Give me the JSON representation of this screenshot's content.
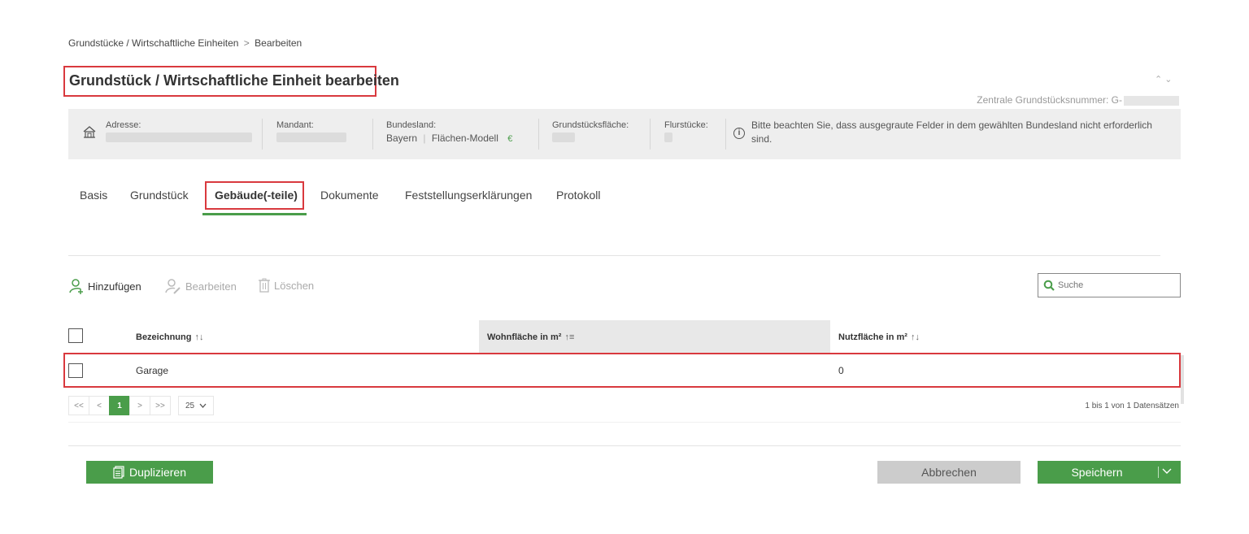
{
  "breadcrumb": {
    "parent": "Grundstücke / Wirtschaftliche Einheiten",
    "separator": ">",
    "current": "Bearbeiten"
  },
  "page_title": "Grundstück / Wirtschaftliche Einheit bearbeiten",
  "central_number_label": "Zentrale Grundstücksnummer: G-",
  "infobar": {
    "address_label": "Adresse:",
    "client_label": "Mandant:",
    "state_label": "Bundesland:",
    "state_value": "Bayern",
    "model_value": "Flächen-Modell",
    "model_icon": "€",
    "area_label": "Grundstücksfläche:",
    "parcels_label": "Flurstücke:",
    "note": "Bitte beachten Sie, dass ausgegraute Felder in dem gewählten Bundesland nicht erforderlich sind."
  },
  "tabs": [
    "Basis",
    "Grundstück",
    "Gebäude(-teile)",
    "Dokumente",
    "Feststellungserklärungen",
    "Protokoll"
  ],
  "active_tab": "Gebäude(-teile)",
  "toolbar": {
    "add_label": "Hinzufügen",
    "edit_label": "Bearbeiten",
    "delete_label": "Löschen"
  },
  "search": {
    "placeholder": "Suche"
  },
  "table": {
    "columns": [
      "Bezeichnung",
      "Wohnfläche in m²",
      "Nutzfläche in m²"
    ],
    "sort_icons": [
      "↑↓",
      "↑≡",
      "↑↓"
    ],
    "rows": [
      {
        "bezeichnung": "Garage",
        "wohnflaeche": "",
        "nutzflaeche": "0"
      }
    ]
  },
  "pager": {
    "first": "<<",
    "prev": "<",
    "current": "1",
    "next": ">",
    "last": ">>",
    "page_size": "25",
    "records": "1 bis 1 von 1 Datensätzen"
  },
  "buttons": {
    "duplicate": "Duplizieren",
    "cancel": "Abbrechen",
    "save": "Speichern"
  },
  "colors": {
    "accent": "#4a9d4a",
    "highlight": "#d9393e",
    "infobar_bg": "#eeeeee"
  }
}
